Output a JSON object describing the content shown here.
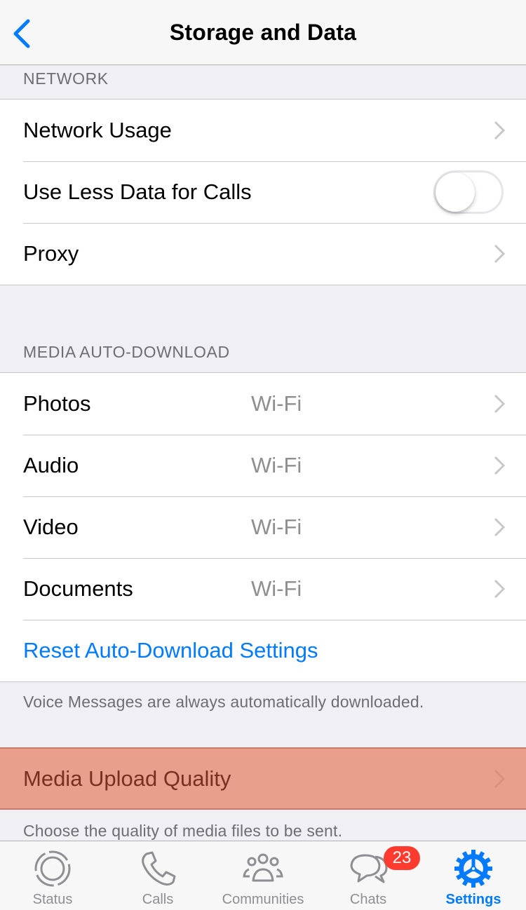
{
  "navbar": {
    "title": "Storage and Data",
    "back_icon": "chevron-left-icon"
  },
  "network": {
    "header": "NETWORK",
    "rows": [
      {
        "label": "Network Usage",
        "type": "disclosure"
      },
      {
        "label": "Use Less Data for Calls",
        "type": "toggle",
        "enabled": false
      },
      {
        "label": "Proxy",
        "type": "disclosure"
      }
    ]
  },
  "media_auto_download": {
    "header": "MEDIA AUTO-DOWNLOAD",
    "rows": [
      {
        "label": "Photos",
        "value": "Wi-Fi"
      },
      {
        "label": "Audio",
        "value": "Wi-Fi"
      },
      {
        "label": "Video",
        "value": "Wi-Fi"
      },
      {
        "label": "Documents",
        "value": "Wi-Fi"
      }
    ],
    "reset_label": "Reset Auto-Download Settings",
    "footer": "Voice Messages are always automatically downloaded."
  },
  "media_upload": {
    "label": "Media Upload Quality",
    "highlighted": true,
    "footer": "Choose the quality of media files to be sent."
  },
  "tabbar": {
    "tabs": [
      {
        "label": "Status",
        "icon": "status-icon",
        "active": false
      },
      {
        "label": "Calls",
        "icon": "phone-icon",
        "active": false
      },
      {
        "label": "Communities",
        "icon": "communities-icon",
        "active": false
      },
      {
        "label": "Chats",
        "icon": "chat-bubbles-icon",
        "active": false,
        "badge": "23"
      },
      {
        "label": "Settings",
        "icon": "gear-icon",
        "active": true
      }
    ]
  },
  "colors": {
    "accent": "#007aff",
    "badge": "#ff3b30",
    "highlight": "#e8a08d",
    "secondary_text": "#8e8e93"
  }
}
